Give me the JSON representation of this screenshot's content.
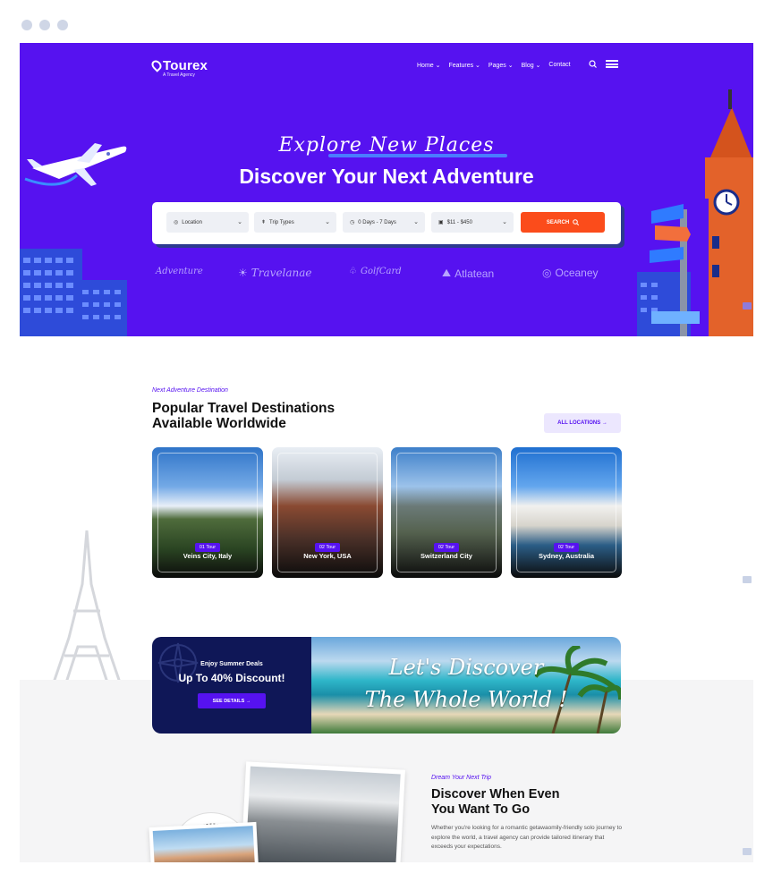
{
  "brand": {
    "name": "Tourex",
    "tagline": "A Travel Agency"
  },
  "nav": {
    "home": "Home ⌄",
    "features": "Features ⌄",
    "pages": "Pages ⌄",
    "blog": "Blog ⌄",
    "contact": "Contact"
  },
  "hero": {
    "script": "Explore New Places",
    "title": "Discover Your Next Adventure"
  },
  "search": {
    "location": "Location",
    "trip_types": "Trip Types",
    "duration": "0 Days - 7 Days",
    "price": "$11 - $450",
    "button": "SEARCH"
  },
  "partners": [
    "Adventure",
    "Travelanae",
    "GolfCard",
    "Atlatean",
    "Oceaney"
  ],
  "destinations": {
    "subtitle": "Next Adventure Destination",
    "title_line1": "Popular Travel Destinations",
    "title_line2": "Available Worldwide",
    "all_button": "ALL LOCATIONS →",
    "cards": [
      {
        "badge": "01 Tour",
        "name": "Veins City, Italy"
      },
      {
        "badge": "02 Tour",
        "name": "New York, USA"
      },
      {
        "badge": "02 Tour",
        "name": "Switzerland City"
      },
      {
        "badge": "02 Tour",
        "name": "Sydney, Australia"
      }
    ]
  },
  "promo": {
    "line1": "Enjoy Summer Deals",
    "line2": "Up To 40% Discount!",
    "button": "SEE DETAILS →",
    "script1": "Let's Discover",
    "script2": "The Whole World !"
  },
  "discover": {
    "subtitle": "Dream Your Next Trip",
    "title_line1": "Discover When Even",
    "title_line2": "You Want To Go",
    "text": "Whether you're looking for a romantic getawaomily-friendly solo journey to explore the world, a travel agency can provide tailored itinerary that exceeds your expectations."
  },
  "colors": {
    "primary": "#5612f0",
    "accent": "#fb4c1b",
    "navy": "#0f1757"
  }
}
